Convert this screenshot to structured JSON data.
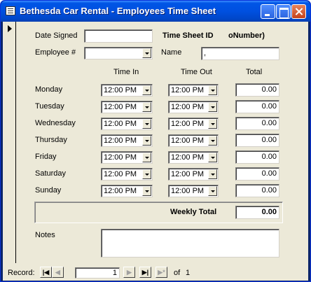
{
  "window": {
    "title": "Bethesda Car Rental - Employees Time Sheet"
  },
  "form": {
    "date_signed_label": "Date Signed",
    "date_signed_value": "",
    "time_sheet_id_label": "Time Sheet ID",
    "time_sheet_id_value": "oNumber)",
    "employee_label": "Employee #",
    "employee_value": "",
    "name_label": "Name",
    "name_value": ",",
    "col_time_in": "Time In",
    "col_time_out": "Time Out",
    "col_total": "Total",
    "days": [
      {
        "day": "Monday",
        "time_in": "12:00 PM",
        "time_out": "12:00 PM",
        "total": "0.00"
      },
      {
        "day": "Tuesday",
        "time_in": "12:00 PM",
        "time_out": "12:00 PM",
        "total": "0.00"
      },
      {
        "day": "Wednesday",
        "time_in": "12:00 PM",
        "time_out": "12:00 PM",
        "total": "0.00"
      },
      {
        "day": "Thursday",
        "time_in": "12:00 PM",
        "time_out": "12:00 PM",
        "total": "0.00"
      },
      {
        "day": "Friday",
        "time_in": "12:00 PM",
        "time_out": "12:00 PM",
        "total": "0.00"
      },
      {
        "day": "Saturday",
        "time_in": "12:00 PM",
        "time_out": "12:00 PM",
        "total": "0.00"
      },
      {
        "day": "Sunday",
        "time_in": "12:00 PM",
        "time_out": "12:00 PM",
        "total": "0.00"
      }
    ],
    "weekly_total_label": "Weekly Total",
    "weekly_total_value": "0.00",
    "notes_label": "Notes",
    "notes_value": ""
  },
  "navigation": {
    "record_label": "Record:",
    "current_record": "1",
    "of_label": "of",
    "total_records": "1"
  }
}
